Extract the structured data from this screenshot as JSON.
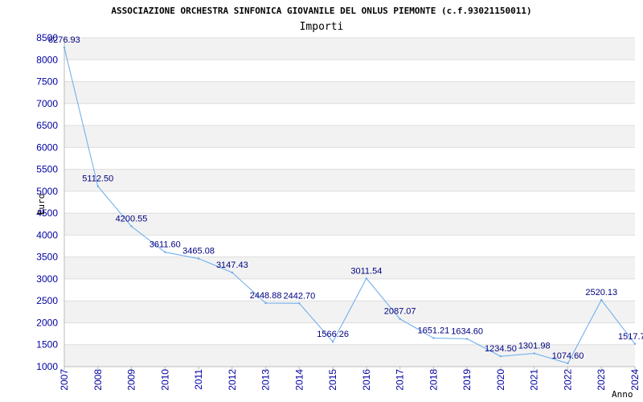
{
  "chart_data": {
    "type": "line",
    "title": "ASSOCIAZIONE ORCHESTRA SINFONICA GIOVANILE DEL ONLUS PIEMONTE (c.f.93021150011)",
    "subtitle": "Importi",
    "xlabel": "Anno",
    "ylabel": "Euro",
    "x": [
      "2007",
      "2008",
      "2009",
      "2010",
      "2011",
      "2012",
      "2013",
      "2014",
      "2015",
      "2016",
      "2017",
      "2018",
      "2019",
      "2020",
      "2021",
      "2022",
      "2023",
      "2024"
    ],
    "values": [
      8276.93,
      5112.5,
      4200.55,
      3611.6,
      3465.08,
      3147.43,
      2448.88,
      2442.7,
      1566.26,
      3011.54,
      2087.07,
      1651.21,
      1634.6,
      1234.5,
      1301.98,
      1074.6,
      2520.13,
      1517.7
    ],
    "value_labels": [
      "8276.93",
      "5112.50",
      "4200.55",
      "3611.60",
      "3465.08",
      "3147.43",
      "2448.88",
      "2442.70",
      "1566.26",
      "3011.54",
      "2087.07",
      "1651.21",
      "1634.60",
      "1234.50",
      "1301.98",
      "1074.60",
      "2520.13",
      "1517.7"
    ],
    "ylim": [
      1000,
      8500
    ],
    "yticks": [
      1000,
      1500,
      2000,
      2500,
      3000,
      3500,
      4000,
      4500,
      5000,
      5500,
      6000,
      6500,
      7000,
      7500,
      8000,
      8500
    ],
    "grid": true,
    "colors": {
      "line": "#66aaee",
      "band": "#f2f2f2",
      "grid": "#dddddd",
      "tick_text": "#0000a0",
      "data_label": "#000080"
    }
  }
}
